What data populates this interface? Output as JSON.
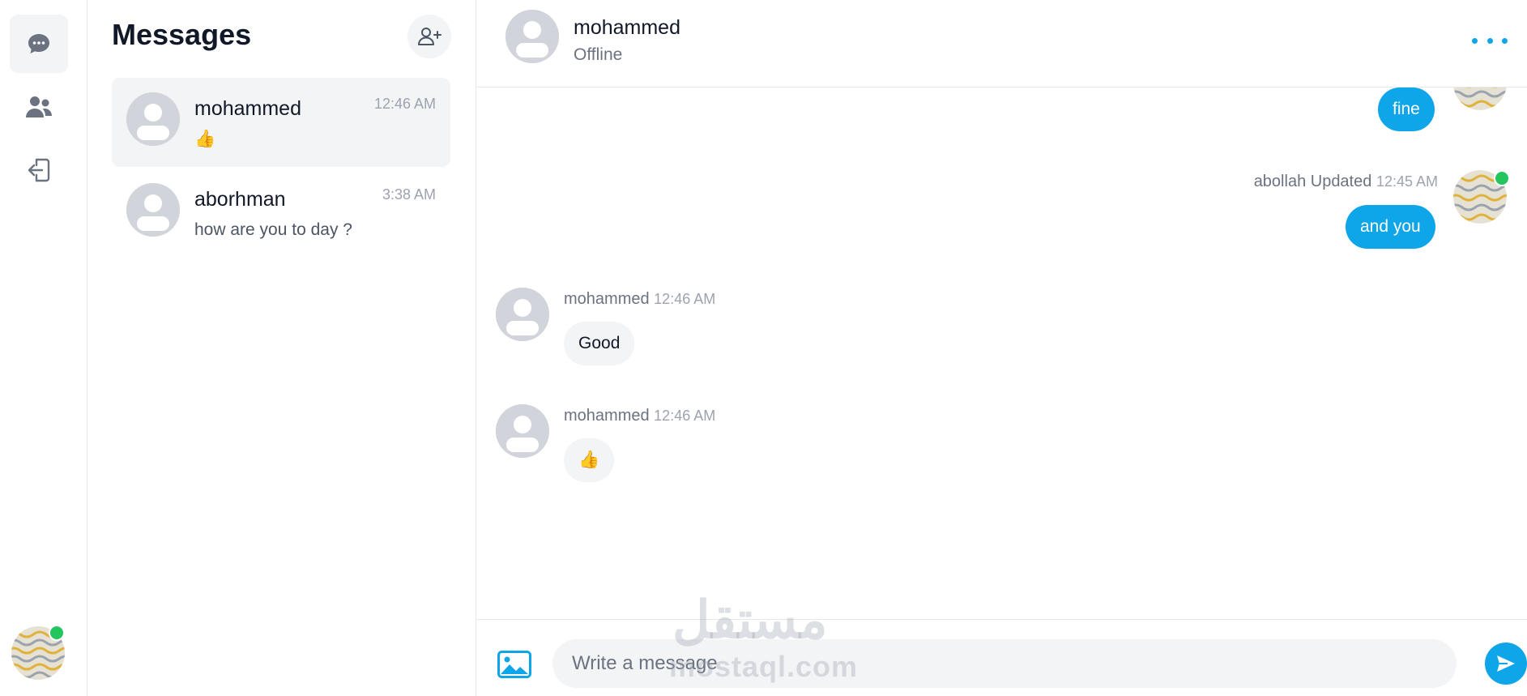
{
  "rail": {
    "items": [
      {
        "icon": "chat-bubble-icon",
        "active": true
      },
      {
        "icon": "users-icon",
        "active": false
      },
      {
        "icon": "logout-icon",
        "active": false
      }
    ]
  },
  "conversations": {
    "title": "Messages",
    "items": [
      {
        "name": "mohammed",
        "time": "12:46 AM",
        "preview": "👍",
        "active": true
      },
      {
        "name": "aborhman",
        "time": "3:38 AM",
        "preview": "how are you to day ?",
        "active": false
      }
    ]
  },
  "chat": {
    "name": "mohammed",
    "status": "Offline",
    "messages": [
      {
        "direction": "out",
        "text": "fine"
      },
      {
        "direction": "out",
        "sender": "abollah Updated",
        "time": "12:45 AM",
        "text": "and you"
      },
      {
        "direction": "in",
        "sender": "mohammed",
        "time": "12:46 AM",
        "text": "Good"
      },
      {
        "direction": "in",
        "sender": "mohammed",
        "time": "12:46 AM",
        "text": "👍"
      }
    ]
  },
  "composer": {
    "placeholder": "Write a message"
  },
  "watermark": {
    "arabic": "مستقل",
    "latin": "mostaql.com"
  },
  "colors": {
    "accent": "#0ea5e9",
    "online": "#22c55e",
    "muted_bg": "#f3f4f6"
  }
}
